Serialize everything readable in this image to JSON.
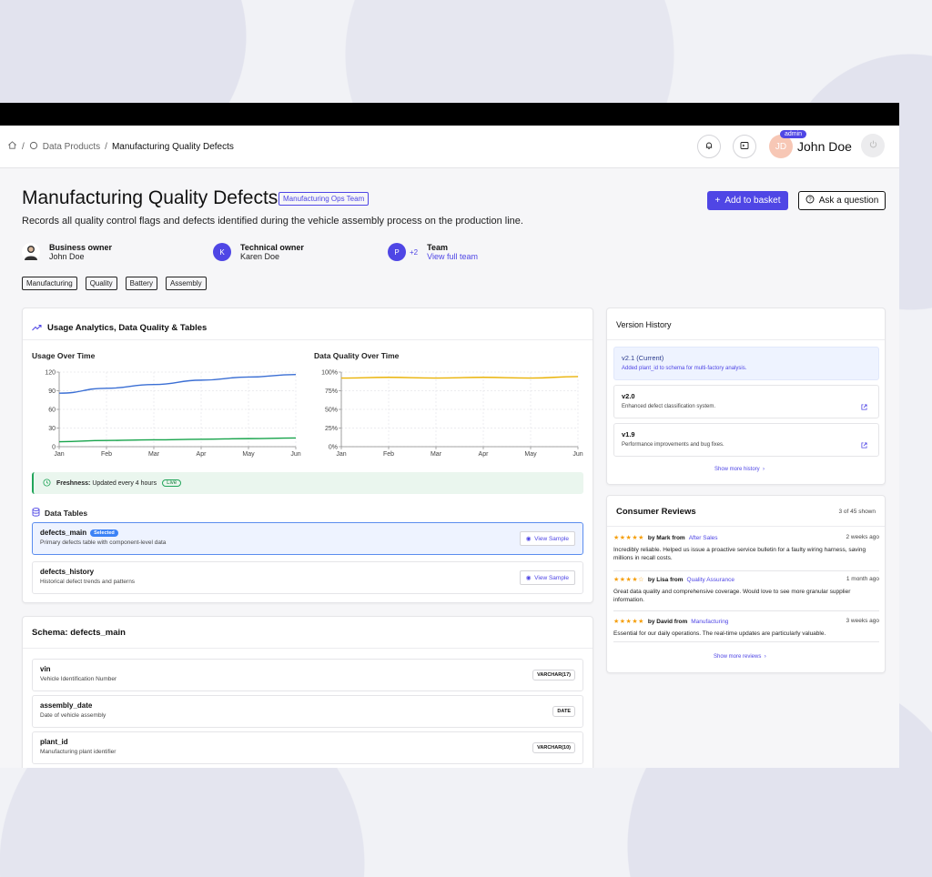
{
  "breadcrumb": {
    "items": [
      "Data Products",
      "Manufacturing Quality Defects"
    ]
  },
  "user": {
    "role_badge": "admin",
    "name": "John Doe",
    "initials": "JD"
  },
  "product": {
    "title": "Manufacturing Quality Defects",
    "team_tag": "Manufacturing Ops Team",
    "description": "Records all quality control flags and defects identified during the vehicle assembly process on the production line.",
    "add_to_basket_label": "Add to basket",
    "ask_question_label": "Ask a question"
  },
  "owners": {
    "business": {
      "label": "Business owner",
      "name": "John Doe"
    },
    "technical": {
      "label": "Technical owner",
      "name": "Karen Doe",
      "initial": "K"
    },
    "team": {
      "label": "Team",
      "link": "View full team",
      "initial": "P",
      "extra": "+2"
    }
  },
  "tags": [
    "Manufacturing",
    "Quality",
    "Battery",
    "Assembly"
  ],
  "analytics": {
    "title": "Usage Analytics, Data Quality & Tables",
    "freshness_label": "Freshness:",
    "freshness_value": "Updated every 4 hours",
    "live_badge": "Live",
    "tables_title": "Data Tables",
    "tables": [
      {
        "name": "defects_main",
        "badge": "Selected",
        "desc": "Primary defects table with component-level data",
        "action": "View Sample"
      },
      {
        "name": "defects_history",
        "desc": "Historical defect trends and patterns",
        "action": "View Sample"
      }
    ]
  },
  "chart_data": [
    {
      "type": "line",
      "title": "Usage Over Time",
      "categories": [
        "Jan",
        "Feb",
        "Mar",
        "Apr",
        "May",
        "Jun"
      ],
      "ylim": [
        0,
        120
      ],
      "yticks": [
        "0",
        "30",
        "60",
        "90",
        "120"
      ],
      "grid": true,
      "series": [
        {
          "color": "#3b6fd4",
          "values": [
            86,
            94,
            100,
            107,
            112,
            116
          ]
        },
        {
          "color": "#16a34a",
          "values": [
            8,
            10,
            11,
            12,
            13,
            14
          ]
        }
      ]
    },
    {
      "type": "line",
      "title": "Data Quality Over Time",
      "categories": [
        "Jan",
        "Feb",
        "Mar",
        "Apr",
        "May",
        "Jun"
      ],
      "ylim": [
        0,
        100
      ],
      "yticks": [
        "0%",
        "25%",
        "50%",
        "75%",
        "100%"
      ],
      "grid": true,
      "series": [
        {
          "color": "#eab308",
          "values": [
            92,
            93,
            92,
            93,
            92,
            94
          ]
        }
      ]
    }
  ],
  "schema": {
    "title": "Schema: defects_main",
    "fields": [
      {
        "name": "vin",
        "desc": "Vehicle Identification Number",
        "type": "VARCHAR(17)"
      },
      {
        "name": "assembly_date",
        "desc": "Date of vehicle assembly",
        "type": "DATE"
      },
      {
        "name": "plant_id",
        "desc": "Manufacturing plant identifier",
        "type": "VARCHAR(10)"
      }
    ]
  },
  "version_history": {
    "title": "Version History",
    "items": [
      {
        "version": "v2.1 (Current)",
        "desc": "Added plant_id to schema for multi-factory analysis."
      },
      {
        "version": "v2.0",
        "desc": "Enhanced defect classification system."
      },
      {
        "version": "v1.9",
        "desc": "Performance improvements and bug fixes."
      }
    ],
    "more_label": "Show more history"
  },
  "reviews": {
    "title": "Consumer Reviews",
    "count": "3 of 45 shown",
    "items": [
      {
        "stars": "★★★★★",
        "by": "by Mark from",
        "dept": "After Sales",
        "when": "2 weeks ago",
        "text": "Incredibly reliable. Helped us issue a proactive service bulletin for a faulty wiring harness, saving millions in recall costs."
      },
      {
        "stars": "★★★★☆",
        "by": "by Lisa from",
        "dept": "Quality Assurance",
        "when": "1 month ago",
        "text": "Great data quality and comprehensive coverage. Would love to see more granular supplier information."
      },
      {
        "stars": "★★★★★",
        "by": "by David from",
        "dept": "Manufacturing",
        "when": "3 weeks ago",
        "text": "Essential for our daily operations. The real-time updates are particularly valuable."
      }
    ],
    "more_label": "Show more reviews"
  },
  "colors": {
    "accent": "#4f46e5",
    "live": "#22a55a",
    "stars": "#f59e0b"
  }
}
